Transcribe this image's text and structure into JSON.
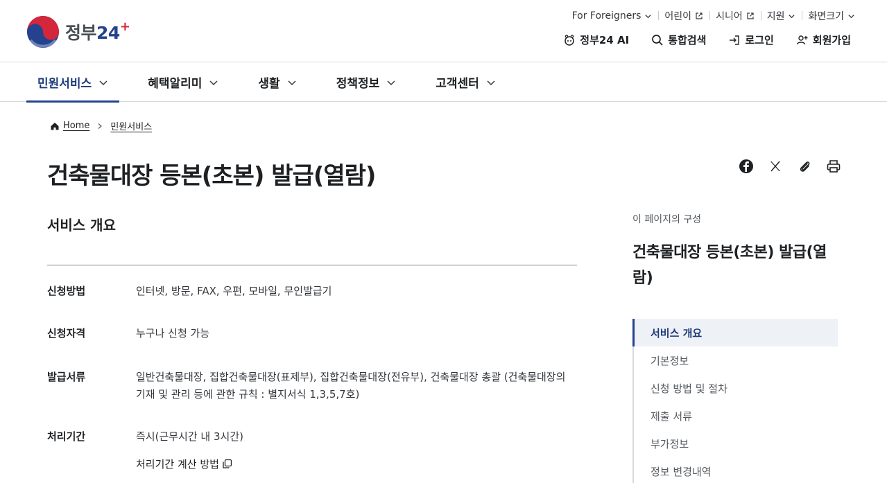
{
  "header": {
    "logo_text": "정부",
    "logo_num": "24",
    "util_links": [
      {
        "label": "For Foreigners",
        "icon": "chevron-down-icon"
      },
      {
        "label": "어린이",
        "icon": "external-link-icon"
      },
      {
        "label": "시니어",
        "icon": "external-link-icon"
      },
      {
        "label": "지원",
        "icon": "chevron-down-icon"
      },
      {
        "label": "화면크기",
        "icon": "chevron-down-icon"
      }
    ],
    "main_links": [
      {
        "label": "정부24 AI",
        "icon": "ai-bot-icon"
      },
      {
        "label": "통합검색",
        "icon": "search-icon"
      },
      {
        "label": "로그인",
        "icon": "login-icon"
      },
      {
        "label": "회원가입",
        "icon": "user-add-icon"
      }
    ]
  },
  "gnb": {
    "items": [
      {
        "label": "민원서비스",
        "active": true
      },
      {
        "label": "혜택알리미",
        "active": false
      },
      {
        "label": "생활",
        "active": false
      },
      {
        "label": "정책정보",
        "active": false
      },
      {
        "label": "고객센터",
        "active": false
      }
    ]
  },
  "breadcrumb": {
    "home": "Home",
    "current": "민원서비스"
  },
  "page": {
    "title": "건축물대장 등본(초본) 발급(열람)"
  },
  "overview": {
    "section_title": "서비스 개요",
    "rows": [
      {
        "label": "신청방법",
        "value": "인터넷, 방문, FAX, 우편, 모바일, 무인발급기"
      },
      {
        "label": "신청자격",
        "value": "누구나 신청 가능"
      },
      {
        "label": "발급서류",
        "value": "일반건축물대장, 집합건축물대장(표제부), 집합건축물대장(전유부), 건축물대장 총괄 (건축물대장의 기재 및 관리 등에 관한 규칙 : 별지서식 1,3,5,7호)"
      },
      {
        "label": "처리기간",
        "value": "즉시(근무시간 내 3시간)"
      }
    ],
    "calc_link": "처리기간 계산 방법"
  },
  "toc": {
    "caption": "이 페이지의 구성",
    "title": "건축물대장 등본(초본) 발급(열람)",
    "items": [
      {
        "label": "서비스 개요",
        "active": true
      },
      {
        "label": "기본정보",
        "active": false
      },
      {
        "label": "신청 방법 및 절차",
        "active": false
      },
      {
        "label": "제출 서류",
        "active": false
      },
      {
        "label": "부가정보",
        "active": false
      },
      {
        "label": "정보 변경내역",
        "active": false
      }
    ]
  },
  "colors": {
    "brand_navy": "#24428e",
    "text_main": "#1e2124",
    "toc_active_bg": "#eef1f5"
  }
}
